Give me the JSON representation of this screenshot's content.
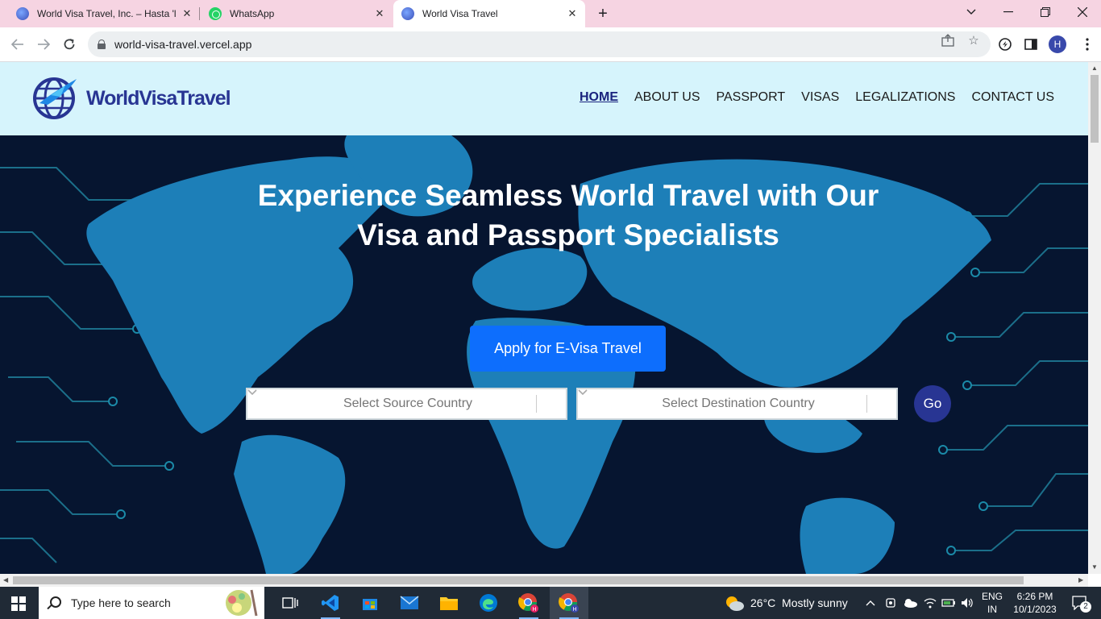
{
  "browser": {
    "tabs": [
      {
        "title": "World Visa Travel, Inc. – Hasta 'la",
        "icon": "globe-icon"
      },
      {
        "title": "WhatsApp",
        "icon": "whatsapp-icon"
      },
      {
        "title": "World Visa Travel",
        "icon": "globe-icon"
      }
    ],
    "url": "world-visa-travel.vercel.app",
    "profile_initial": "H"
  },
  "site": {
    "logo": "WorldVisaTravel",
    "nav": [
      "HOME",
      "ABOUT US",
      "PASSPORT",
      "VISAS",
      "LEGALIZATIONS",
      "CONTACT US"
    ],
    "headline_line1": "Experience Seamless World Travel with Our",
    "headline_line2": "Visa and Passport Specialists",
    "cta": "Apply for E-Visa Travel",
    "source_placeholder": "Select Source Country",
    "destination_placeholder": "Select Destination Country",
    "go": "Go"
  },
  "taskbar": {
    "search_placeholder": "Type here to search",
    "weather": "26°C  Mostly sunny",
    "lang_line1": "ENG",
    "lang_line2": "IN",
    "time": "6:26 PM",
    "date": "10/1/2023",
    "notifications": "2"
  },
  "colors": {
    "tab_strip": "#f6d4e2",
    "header_bg": "#d6f4fc",
    "hero_bg": "#061530",
    "map_blue": "#1d7fb8",
    "cta_blue": "#0d6efd",
    "go_button": "#283593"
  }
}
